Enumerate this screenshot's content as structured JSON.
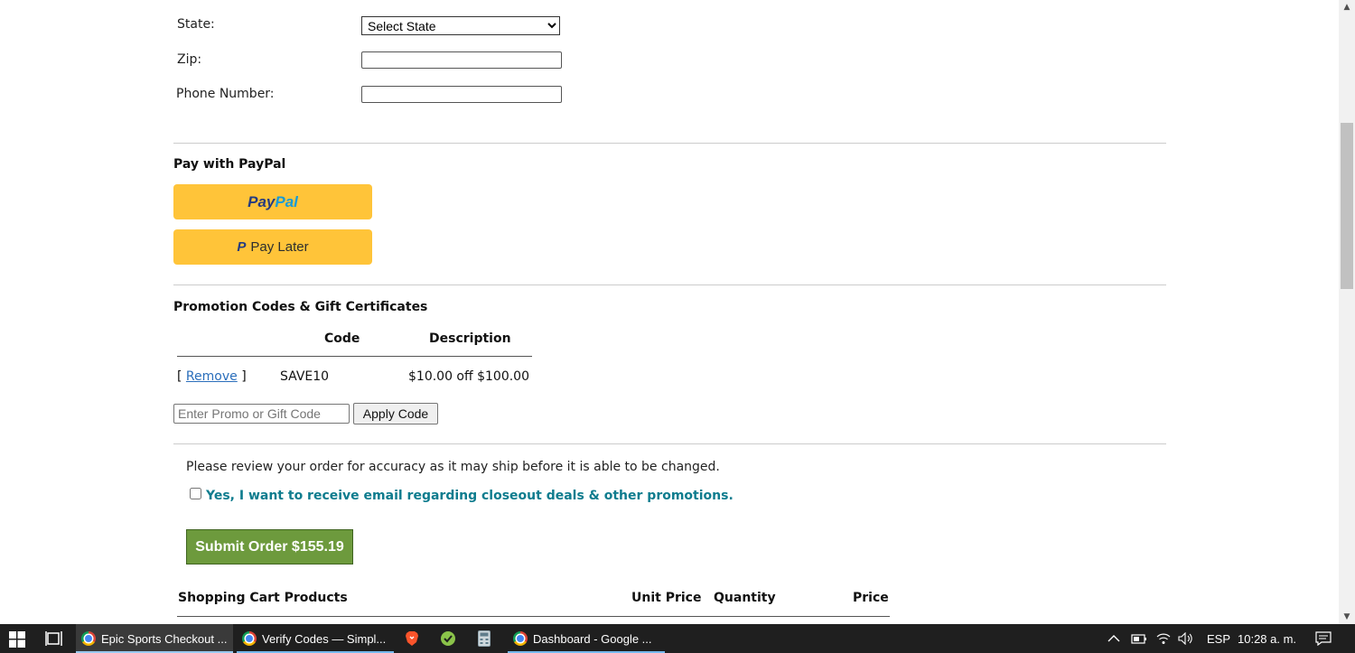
{
  "form": {
    "state_label": "State:",
    "state_selected": "Select State",
    "zip_label": "Zip:",
    "phone_label": "Phone Number:"
  },
  "paypal": {
    "title": "Pay with PayPal",
    "button_logo_part1": "Pay",
    "button_logo_part2": "Pal",
    "pay_later_label": "Pay Later",
    "button_color": "#ffc439"
  },
  "promo": {
    "title": "Promotion Codes & Gift Certificates",
    "columns": [
      "Code",
      "Description"
    ],
    "rows": [
      {
        "remove_open": "[",
        "remove_label": "Remove",
        "remove_close": "]",
        "code": "SAVE10",
        "description": "$10.00 off $100.00"
      }
    ],
    "input_placeholder": "Enter Promo or Gift Code",
    "apply_label": "Apply Code"
  },
  "review": {
    "notice": "Please review your order for accuracy as it may ship before it is able to be changed.",
    "optin_label": "Yes, I want to receive email regarding closeout deals & other promotions.",
    "optin_checked": false,
    "optin_color": "#0e7c8e"
  },
  "submit": {
    "label": "Submit Order $155.19",
    "color": "#6d9a3d"
  },
  "cart": {
    "title": "Shopping Cart Products",
    "columns": [
      "Unit Price",
      "Quantity",
      "Price"
    ]
  },
  "taskbar": {
    "windows": [
      {
        "label": "Epic Sports Checkout ...",
        "icon": "chrome-icon",
        "active": true
      },
      {
        "label": "Verify Codes — Simpl...",
        "icon": "chrome-icon",
        "active": false
      },
      {
        "label": "Dashboard - Google ...",
        "icon": "chrome-icon",
        "active": false
      }
    ],
    "pinned": [
      "brave-icon",
      "app-icon",
      "calculator-icon"
    ],
    "language": "ESP",
    "time": "10:28 a. m."
  }
}
